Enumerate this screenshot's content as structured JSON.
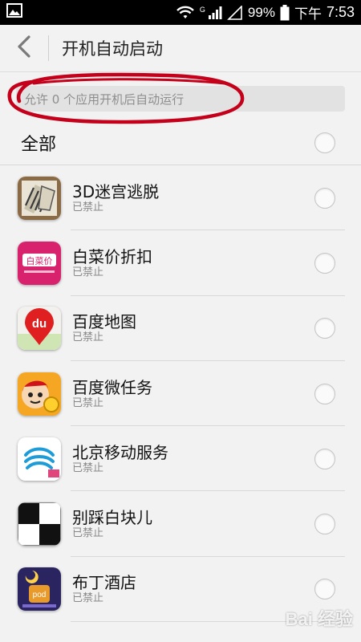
{
  "status_bar": {
    "battery": "99%",
    "ampm": "下午",
    "time": "7:53",
    "network_mark": "G"
  },
  "header": {
    "title": "开机自动启动",
    "back_icon": "chevron-left-icon"
  },
  "info": {
    "text": "允许 0 个应用开机后自动运行"
  },
  "all_toggle": {
    "label": "全部"
  },
  "apps": [
    {
      "name": "3D迷宫逃脱",
      "status": "已禁止",
      "icon": "maze-icon"
    },
    {
      "name": "白菜价折扣",
      "status": "已禁止",
      "icon": "baicaijia-icon",
      "icon_text": "白菜价"
    },
    {
      "name": "百度地图",
      "status": "已禁止",
      "icon": "baidu-map-icon",
      "icon_text": "du"
    },
    {
      "name": "百度微任务",
      "status": "已禁止",
      "icon": "baidu-task-icon"
    },
    {
      "name": "北京移动服务",
      "status": "已禁止",
      "icon": "china-mobile-icon"
    },
    {
      "name": "别踩白块儿",
      "status": "已禁止",
      "icon": "piano-tiles-icon"
    },
    {
      "name": "布丁酒店",
      "status": "已禁止",
      "icon": "pudding-hotel-icon",
      "icon_text": "pod"
    }
  ],
  "colors": {
    "annotation_red": "#c4001a",
    "info_bg": "#e2e2e2"
  },
  "watermark": "Bai 经验"
}
